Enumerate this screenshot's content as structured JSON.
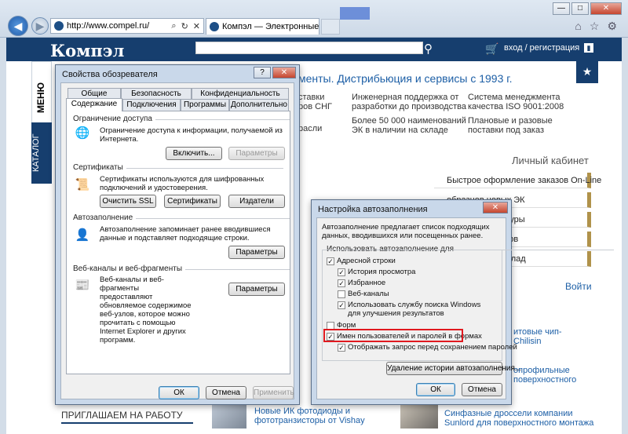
{
  "browser": {
    "url": "http://www.compel.ru/",
    "tab_title": "Компэл — Электронные к...",
    "back_icon": "back-arrow-icon",
    "forward_icon": "forward-arrow-icon",
    "window_buttons": [
      "—",
      "□",
      "✕"
    ],
    "tools_icons": [
      "home-icon",
      "star-icon",
      "gear-icon"
    ]
  },
  "site": {
    "logo": "Компэл",
    "login": "вход / регистрация",
    "menu": "МЕНЮ",
    "catalog": "КАТАЛОГ",
    "tagline": "менты. Дистрибьюция и сервисы с 1993 г.",
    "features": [
      "ставки",
      "ров СНГ",
      "Инженерная поддержка от",
      "разработки до производства",
      "Система менеджмента",
      "качества ISO 9001:2008",
      "расли",
      "Более 50 000 наименований",
      "ЭК в наличии на складе",
      "Плановые и разовые",
      "поставки под заказ"
    ],
    "cabinet_title": "Личный кабинет",
    "cabinet_items": [
      "Быстрое оформление заказов On-Line",
      "образцов новых ЭК",
      "иска номенклатуры",
      "хранения списков",
      "ступлении на склад"
    ],
    "enter": "Войти",
    "news": [
      "итовые чип-",
      "Chilisin",
      "опрофильные",
      "поверхностного",
      "Новые ИК фотодиоды и",
      "фототранзисторы от Vishay",
      "Синфазные дроссели компании",
      "Sunlord для поверхностного монтажа"
    ],
    "jobs": "ПРИГЛАШАЕМ НА РАБОТУ"
  },
  "props_dialog": {
    "title": "Свойства обозревателя",
    "help": "?",
    "close": "✕",
    "tabs_row1": [
      "Общие",
      "Безопасность",
      "Конфиденциальность"
    ],
    "tabs_row2": [
      "Содержание",
      "Подключения",
      "Программы",
      "Дополнительно"
    ],
    "groups": {
      "access": {
        "title": "Ограничение доступа",
        "text": "Ограничение доступа к информации, получаемой из Интернета.",
        "enable": "Включить...",
        "params": "Параметры"
      },
      "certs": {
        "title": "Сертификаты",
        "text": "Сертификаты используются для шифрованных подключений и удостоверения.",
        "clear_ssl": "Очистить SSL",
        "certificates": "Сертификаты",
        "publishers": "Издатели"
      },
      "autocomplete": {
        "title": "Автозаполнение",
        "text": "Автозаполнение запоминает ранее вводившиеся данные и подставляет подходящие строки.",
        "params": "Параметры"
      },
      "feeds": {
        "title": "Веб-каналы и веб-фрагменты",
        "text": "Веб-каналы и веб-фрагменты предоставляют обновляемое содержимое веб-узлов, которое можно прочитать с помощью Internet Explorer и других программ.",
        "params": "Параметры"
      }
    },
    "ok": "ОК",
    "cancel": "Отмена",
    "apply": "Применить"
  },
  "autofill_dialog": {
    "title": "Настройка автозаполнения",
    "close": "✕",
    "intro": "Автозаполнение предлагает список подходящих данных, вводившихся или посещенных ранее.",
    "group_title": "Использовать автозаполнение для",
    "options": [
      {
        "label": "Адресной строки",
        "checked": true
      },
      {
        "label": "История просмотра",
        "checked": true
      },
      {
        "label": "Избранное",
        "checked": true
      },
      {
        "label": "Веб-каналы",
        "checked": false
      },
      {
        "label": "Использовать службу поиска Windows для улучшения результатов",
        "checked": true
      },
      {
        "label": "Форм",
        "checked": false
      },
      {
        "label": "Имен пользователей и паролей в формах",
        "checked": true
      },
      {
        "label": "Отображать запрос перед сохранением паролей",
        "checked": true
      }
    ],
    "delete_history": "Удаление истории автозаполнения...",
    "ok": "ОК",
    "cancel": "Отмена"
  }
}
